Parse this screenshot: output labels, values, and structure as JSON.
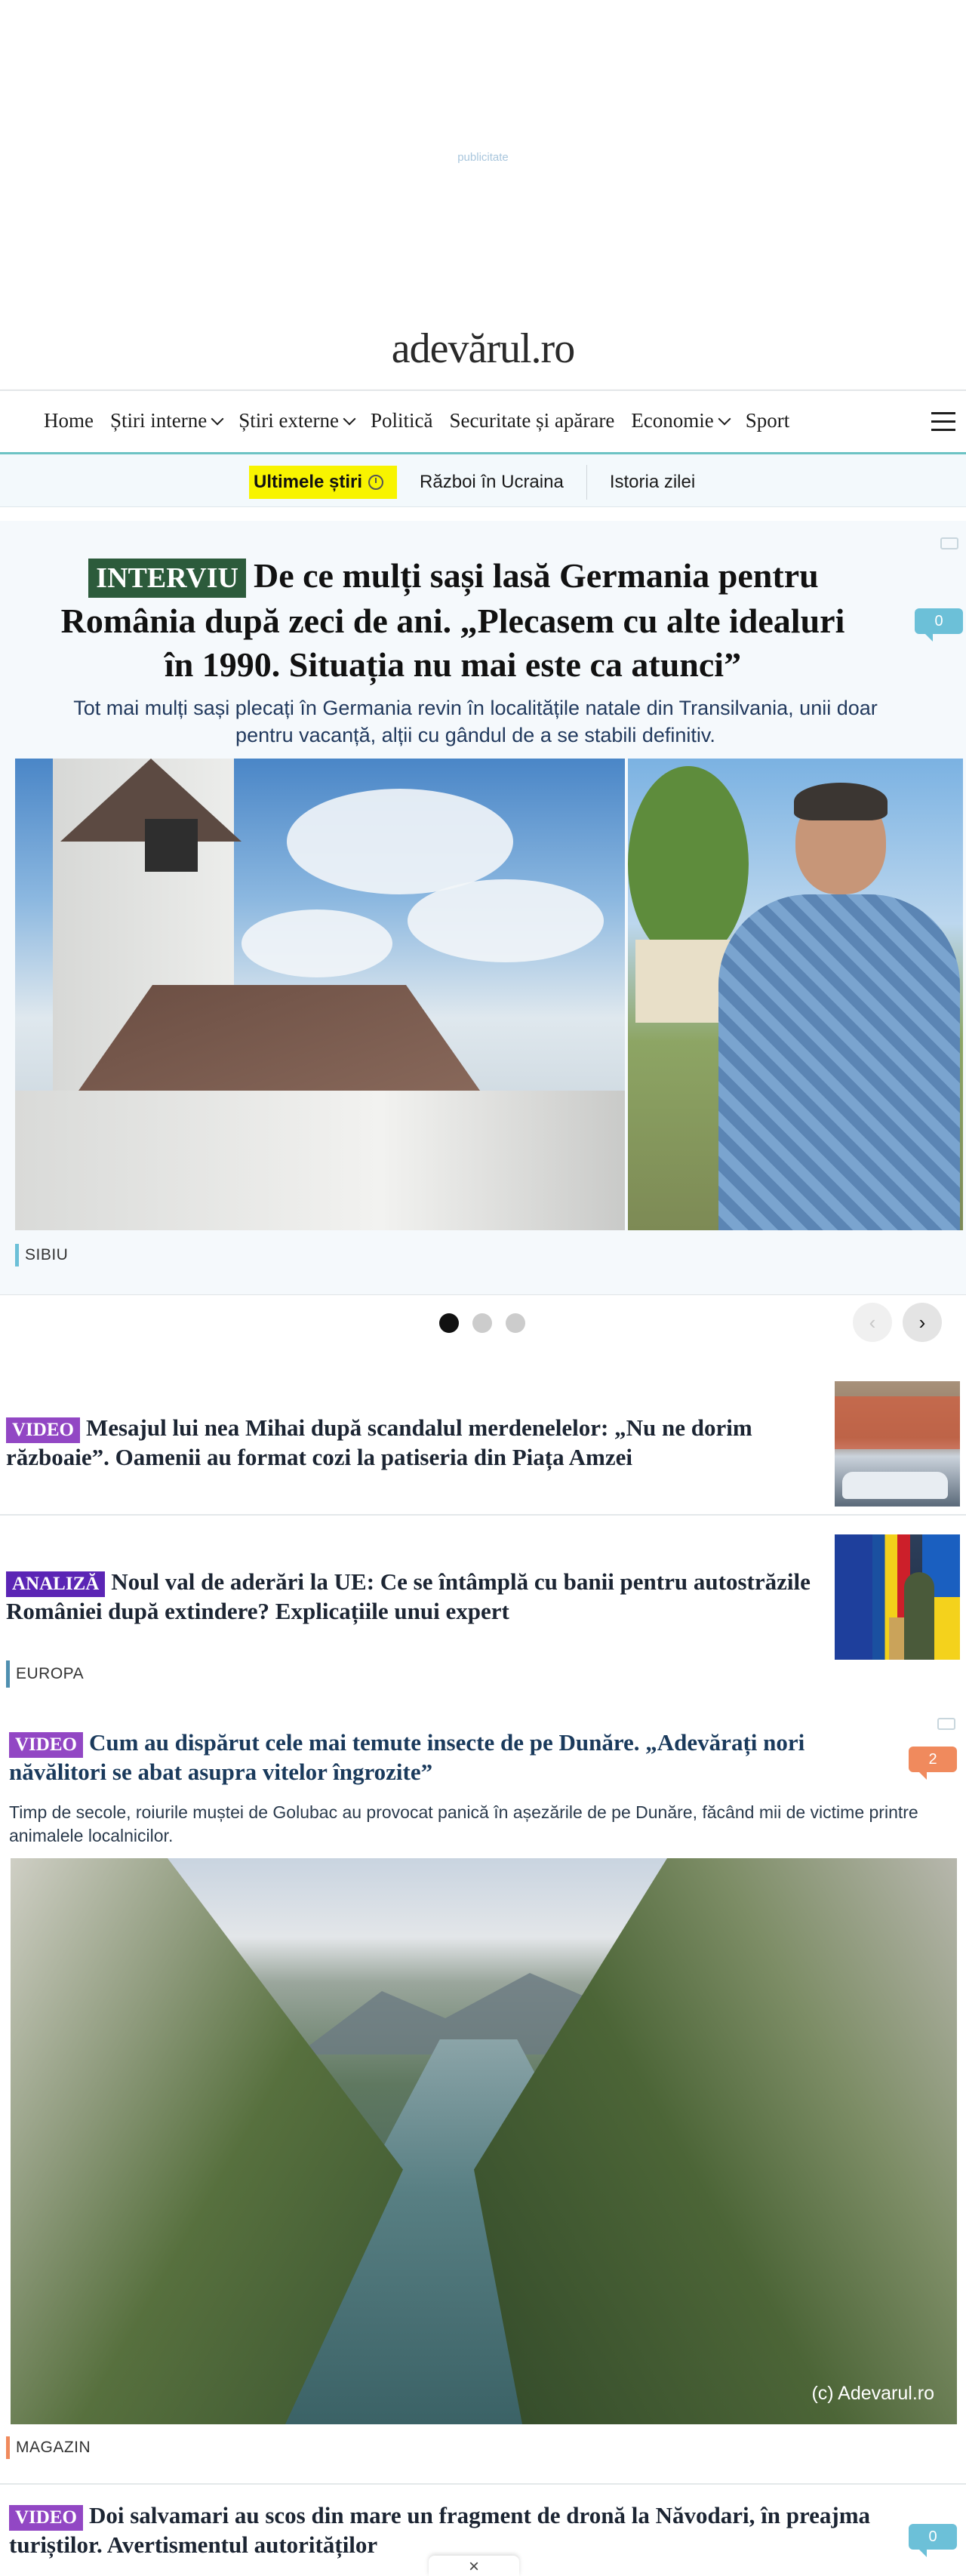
{
  "ad": {
    "label": "publicitate"
  },
  "site": {
    "logo": "adevărul.ro"
  },
  "nav": {
    "items": [
      {
        "label": "Home",
        "dropdown": false
      },
      {
        "label": "Știri interne",
        "dropdown": true
      },
      {
        "label": "Știri externe",
        "dropdown": true
      },
      {
        "label": "Politică",
        "dropdown": false
      },
      {
        "label": "Securitate și apărare",
        "dropdown": false
      },
      {
        "label": "Economie",
        "dropdown": true
      },
      {
        "label": "Sport",
        "dropdown": false
      }
    ]
  },
  "subnav": {
    "hot": "Ultimele știri",
    "links": [
      "Război în Ucraina",
      "Istoria zilei"
    ]
  },
  "hero": {
    "tag": "INTERVIU",
    "title": "De ce mulți sași lasă Germania pentru România după zeci de ani. „Plecasem cu alte idealuri în 1990. Situația nu mai este ca atunci”",
    "lead": "Tot mai mulți sași plecați în Germania revin în localitățile natale din Transilvania, unii doar pentru vacanță, alții cu gândul de a se stabili definitiv.",
    "comments": "0",
    "section": "SIBIU",
    "section_color": "#6cc0d8"
  },
  "carousel": {
    "prev": "‹",
    "next": "›"
  },
  "articles": [
    {
      "tag": "VIDEO",
      "title": "Mesajul lui nea Mihai după scandalul merdenelelor: „Nu ne dorim războaie”. Oamenii au format cozi la patiseria din Piața Amzei"
    },
    {
      "tag": "ANALIZĂ",
      "title": "Noul val de aderări la UE: Ce se întâmplă cu banii pentru autostrăzile României după extindere? Explicațiile unui expert",
      "section": "EUROPA",
      "section_color": "#4f8fb0"
    }
  ],
  "feature": {
    "tag": "VIDEO",
    "title": "Cum au dispărut cele mai temute insecte de pe Dunăre. „Adevărați nori năvălitori se abat asupra vitelor îngrozite”",
    "lead": "Timp de secole, roiurile muștei de Golubac au provocat panică în așezările de pe Dunăre, făcând mii de victime printre animalele localnicilor.",
    "comments": "2",
    "watermark": "(c) Adevarul.ro",
    "section": "MAGAZIN",
    "section_color": "#f08a5d"
  },
  "bottom": {
    "tag": "VIDEO",
    "title": "Doi salvamari au scos din mare un fragment de dronă la Năvodari, în preajma turiștilor. Avertismentul autorităților",
    "comments": "0"
  },
  "close_tab": {
    "label": "×"
  }
}
